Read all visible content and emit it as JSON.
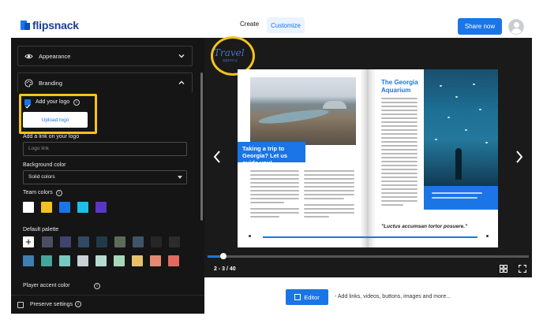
{
  "app": {
    "brand": "flipsnack"
  },
  "topbar": {
    "tabs": [
      {
        "label": "Create"
      },
      {
        "label": "Customize"
      }
    ],
    "share_label": "Share now"
  },
  "sidebar": {
    "appearance_label": "Appearance",
    "branding_label": "Branding",
    "add_logo_label": "Add your logo",
    "upload_logo_label": "Upload logo",
    "link_label": "Add a link on your logo",
    "link_placeholder": "Logo link",
    "bg_color_label": "Background color",
    "bg_color_value": "Solid colors",
    "team_colors_label": "Team colors",
    "default_palette_label": "Default palette",
    "player_accent_label": "Player accent color",
    "preserve_label": "Preserve settings",
    "team_colors": [
      "#ffffff",
      "#f5c21b",
      "#1b75e6",
      "#17c3e8",
      "#5a35c9"
    ],
    "palette_row1": [
      "#ffffff",
      "#4a4f63",
      "#3d4470",
      "#2f4a62",
      "#1f3a4a",
      "#5a6b5a",
      "#3f5566",
      "#262626",
      "#2c2c2c"
    ],
    "palette_row2": [
      "#3f7fb0",
      "#46a59b",
      "#79c9c0",
      "#c7d1d6",
      "#b6dad3",
      "#a7d6bb",
      "#e8c06a",
      "#e58a72",
      "#e06a5f"
    ]
  },
  "viewer": {
    "logo_text": "Travel",
    "logo_subtext": "agency",
    "headline": "Taking a trip to Georgia? Let us guide you!",
    "right_title": "The Georgia Aquarium",
    "quote": "\"Luctus accumsan tortor posuere.\"",
    "page_indicator": "2 - 3 / 40",
    "progress": 0.05
  },
  "bottom": {
    "editor_label": "Editor",
    "hint": "- Add links, videos, buttons, images and more..."
  },
  "colors": {
    "accent": "#1b75e6",
    "highlight": "#f5c21b",
    "panel": "#151515"
  }
}
